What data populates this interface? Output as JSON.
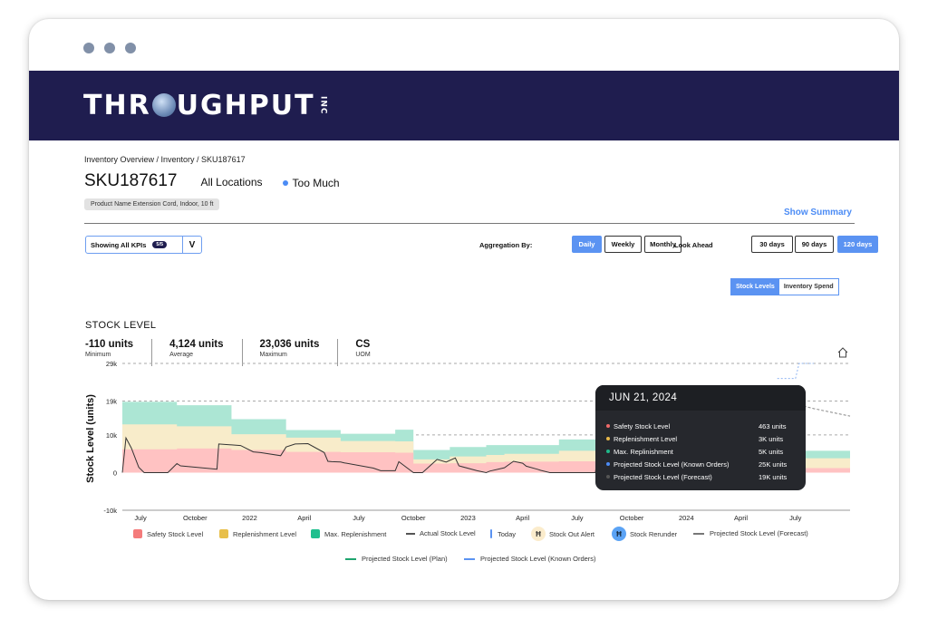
{
  "window": {
    "dots": 3
  },
  "brand": {
    "logo_prefix": "THR",
    "logo_suffix": "UGHPUT",
    "logo_inc": "INC"
  },
  "breadcrumb": "Inventory Overview / Inventory / SKU187617",
  "header": {
    "sku": "SKU187617",
    "locations": "All Locations",
    "status": "Too Much",
    "status_color": "#4c8cf5",
    "product_chip": "Product Name Extension Cord, Indoor, 10 ft",
    "show_summary": "Show Summary"
  },
  "controls": {
    "kpi_select_label": "Showing All KPIs",
    "kpi_badge": "5/5",
    "kpi_chevron": "V",
    "aggregation_label": "Aggregation By:",
    "aggregation_options": [
      {
        "label": "Daily",
        "active": true
      },
      {
        "label": "Weekly",
        "active": false
      },
      {
        "label": "Monthly",
        "active": false
      }
    ],
    "look_ahead_label": "Look Ahead",
    "look_ahead_options": [
      {
        "label": "30 days",
        "active": false
      },
      {
        "label": "90 days",
        "active": false
      },
      {
        "label": "120 days",
        "active": true
      }
    ],
    "view_toggle": [
      {
        "label": "Stock Levels",
        "active": true
      },
      {
        "label": "Inventory Spend",
        "active": false
      }
    ]
  },
  "stock_section": {
    "title": "STOCK LEVEL",
    "stats": [
      {
        "value": "-110 units",
        "label": "Minimum"
      },
      {
        "value": "4,124 units",
        "label": "Average"
      },
      {
        "value": "23,036 units",
        "label": "Maximum"
      },
      {
        "value": "CS",
        "label": "UOM"
      }
    ]
  },
  "tooltip": {
    "date": "JUN 21, 2024",
    "rows": [
      {
        "name": "Safety Stock Level",
        "value": "463 units",
        "color": "#f06a6a"
      },
      {
        "name": "Replenishment Level",
        "value": "3K units",
        "color": "#e8b84a"
      },
      {
        "name": "Max. Replinishment",
        "value": "5K units",
        "color": "#1fb98a"
      },
      {
        "name": "Projected Stock Level (Known Orders)",
        "value": "25K units",
        "color": "#4c8cf5"
      },
      {
        "name": "Projected Stock Level (Forecast)",
        "value": "19K units",
        "color": "#555555"
      }
    ]
  },
  "legend": {
    "safety": "Safety Stock Level",
    "replenishment": "Replenishment Level",
    "max_replenishment": "Max. Replenishment",
    "actual": "Actual Stock Level",
    "today": "Today",
    "stock_out": "Stock Out Alert",
    "rerunder": "Stock Rerunder",
    "forecast": "Projected Stock Level (Forecast)",
    "plan": "Projected Stock Level (Plan)",
    "known_orders": "Projected Stock Level (Known Orders)",
    "stock_out_glyph": "Ħ",
    "rerunder_glyph": "Ħ"
  },
  "colors": {
    "brand_navy": "#1f1d4f",
    "accent_blue": "#5b93f2",
    "safety": "#ffc2c2",
    "replenishment": "#f8ecca",
    "max_replenishment": "#ace6d4"
  },
  "chart_data": {
    "type": "area",
    "title": "STOCK LEVEL",
    "ylabel": "Stock Level (units)",
    "xlabel": "",
    "ylim": [
      -10000,
      29000
    ],
    "yticks": [
      {
        "value": 29000,
        "label": "29k"
      },
      {
        "value": 19000,
        "label": "19k"
      },
      {
        "value": 10000,
        "label": "10k"
      },
      {
        "value": 0,
        "label": "0"
      },
      {
        "value": -10000,
        "label": "-10k"
      }
    ],
    "xticks": [
      "July",
      "October",
      "2022",
      "April",
      "July",
      "October",
      "2023",
      "April",
      "July",
      "October",
      "2024",
      "April",
      "July"
    ],
    "x_range_months": [
      0,
      40
    ],
    "xtick_positions_months": [
      1,
      4,
      7,
      10,
      13,
      16,
      19,
      22,
      25,
      28,
      31,
      34,
      37
    ],
    "grid": "dashed horizontal at 29k, 19k, 10k",
    "legend_position": "bottom",
    "series": [
      {
        "name": "Safety Stock Level",
        "type": "step-area",
        "x": [
          0,
          3,
          6,
          9,
          12,
          15,
          16,
          18,
          20,
          21,
          24,
          27,
          30,
          33,
          36,
          40
        ],
        "values": [
          6200,
          6400,
          6000,
          5500,
          5400,
          5300,
          2400,
          2500,
          2800,
          2900,
          3000,
          3400,
          4000,
          3800,
          1200,
          600
        ]
      },
      {
        "name": "Replenishment Level",
        "type": "step-area",
        "x": [
          0,
          3,
          6,
          9,
          12,
          15,
          16,
          18,
          20,
          21,
          24,
          27,
          30,
          33,
          36,
          40
        ],
        "values": [
          12800,
          12300,
          10200,
          9300,
          8400,
          8300,
          3500,
          4300,
          4700,
          5000,
          5800,
          7400,
          7800,
          6900,
          3800,
          4200
        ]
      },
      {
        "name": "Max. Replenishment",
        "type": "step-area",
        "x": [
          0,
          3,
          6,
          9,
          12,
          15,
          16,
          18,
          20,
          21,
          24,
          27,
          30,
          33,
          36,
          40
        ],
        "values": [
          18800,
          17900,
          14200,
          11300,
          10300,
          11400,
          6000,
          6800,
          7300,
          7300,
          8800,
          11300,
          12200,
          10000,
          5800,
          6900
        ]
      },
      {
        "name": "Actual Stock Level",
        "type": "line",
        "x": [
          0,
          0.2,
          0.5,
          0.9,
          1.2,
          1.5,
          2.5,
          3.0,
          3.2,
          5.2,
          5.3,
          6.5,
          7.2,
          7.6,
          8.7,
          9.0,
          9.5,
          10.2,
          11.1,
          11.3,
          11.5,
          12.0,
          12.2,
          13.8,
          14.2,
          15.0,
          15.2,
          16.0,
          16.5,
          17.3,
          17.8,
          18.3,
          18.5,
          19.5,
          20.0,
          20.2,
          21.0,
          21.5,
          22.0,
          22.2,
          22.8,
          23.0,
          23.5,
          24.0,
          25.0,
          26.0,
          26.2,
          27.0,
          27.2,
          28.0,
          29.0,
          30.0,
          30.3,
          31.0,
          32.0,
          33.0,
          34.0,
          35.0,
          36.0
        ],
        "values": [
          0,
          9200,
          6500,
          1400,
          0,
          0,
          0,
          2400,
          1800,
          900,
          7600,
          7200,
          5500,
          5300,
          4500,
          6800,
          7600,
          7700,
          5300,
          3000,
          2900,
          2800,
          2600,
          1200,
          500,
          500,
          2900,
          0,
          0,
          3500,
          2800,
          3900,
          1800,
          500,
          0,
          400,
          1300,
          3000,
          2500,
          1700,
          900,
          600,
          0,
          0,
          0,
          0,
          7300,
          4500,
          7200,
          6100,
          7400,
          5500,
          4200,
          4100,
          5700,
          8600,
          7800,
          6200,
          5000
        ]
      },
      {
        "name": "Projected Stock Level (Known Orders)",
        "type": "dotted-line",
        "x": [
          36,
          37,
          37.2,
          38
        ],
        "values": [
          25000,
          25000,
          29000,
          29000
        ]
      },
      {
        "name": "Projected Stock Level (Forecast)",
        "type": "dashed-line",
        "x": [
          36,
          38,
          40
        ],
        "values": [
          19500,
          17000,
          15000
        ]
      }
    ],
    "tooltip_point": {
      "date": "JUN 21, 2024",
      "Safety Stock Level": 463,
      "Replenishment Level": 3000,
      "Max. Replinishment": 5000,
      "Projected Stock Level (Known Orders)": 25000,
      "Projected Stock Level (Forecast)": 19000
    }
  }
}
